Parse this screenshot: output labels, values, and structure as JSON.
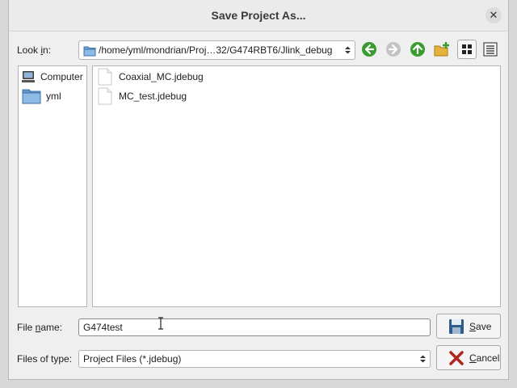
{
  "dialog": {
    "title": "Save Project As...",
    "close_glyph": "✕"
  },
  "look_in": {
    "label_before": "Look ",
    "label_mnemonic": "i",
    "label_after": "n:",
    "path": "/home/yml/mondrian/Proj…32/G474RBT6/Jlink_debug",
    "folder_icon": "folder-icon"
  },
  "toolbar": {
    "back_icon": "back-arrow-icon",
    "forward_icon": "forward-arrow-icon",
    "up_icon": "parent-directory-icon",
    "new_folder_icon": "new-folder-icon",
    "icon_view_icon": "icon-view-icon",
    "detail_view_icon": "detail-view-icon"
  },
  "sidebar": {
    "items": [
      {
        "label": "Computer",
        "icon": "computer-icon"
      },
      {
        "label": "yml",
        "icon": "folder-icon"
      }
    ]
  },
  "files": [
    {
      "name": "Coaxial_MC.jdebug",
      "icon": "file-icon"
    },
    {
      "name": "MC_test.jdebug",
      "icon": "file-icon"
    }
  ],
  "file_name": {
    "label_before": "File ",
    "label_mnemonic": "n",
    "label_after": "ame:",
    "value": "G474test"
  },
  "file_type": {
    "label": "Files of type:",
    "value": "Project Files (*.jdebug)"
  },
  "buttons": {
    "save_mnemonic": "S",
    "save_rest": "ave",
    "cancel_mnemonic": "C",
    "cancel_rest": "ancel"
  },
  "colors": {
    "accent_green": "#3a9b2e",
    "folder_blue": "#6fa6da",
    "cancel_red": "#b0241c"
  }
}
